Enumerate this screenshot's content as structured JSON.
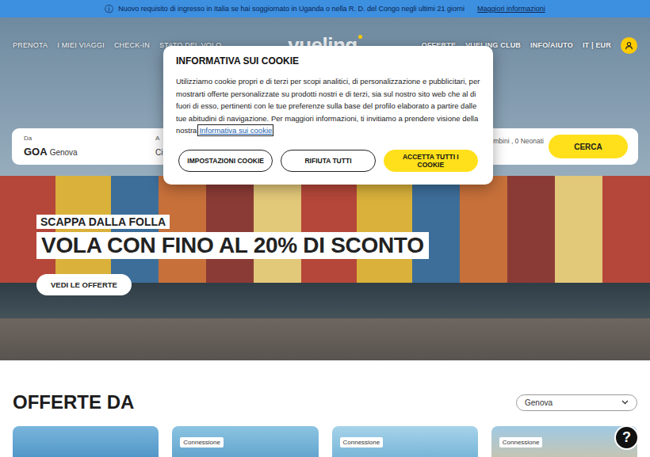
{
  "notice": {
    "icon": "ⓘ",
    "text": "Nuovo requisito di ingresso in Italia se hai soggiornato in Uganda o nella R. D. del Congo negli ultimi 21 giorni",
    "link": "Maggiori informazioni"
  },
  "nav_left": [
    "PRENOTA",
    "I MIEI VIAGGI",
    "CHECK-IN",
    "STATO DEL VOLO"
  ],
  "logo": "vueling",
  "nav_right": [
    "OFFERTE",
    "VUELING CLUB",
    "INFO/AIUTO",
    "IT | EUR"
  ],
  "search": {
    "fields": [
      {
        "label": "Da",
        "code": "GOA",
        "city": "Genova"
      },
      {
        "label": "A",
        "city": "Ci"
      }
    ],
    "passengers": "mbini , 0 Neonati",
    "button": "CERCA"
  },
  "hero": {
    "eyebrow": "SCAPPA DALLA FOLLA",
    "headline": "VOLA CON FINO AL 20% DI SCONTO",
    "button": "VEDI LE OFFERTE"
  },
  "offers": {
    "title": "OFFERTE DA",
    "select": "Genova",
    "cards": [
      {
        "kind": "plain"
      },
      {
        "kind": "tagged",
        "tag": "Connessione"
      },
      {
        "kind": "tagged",
        "tag": "Connessione"
      },
      {
        "kind": "tagged",
        "tag": "Connessione"
      }
    ]
  },
  "help": "?",
  "cookie_modal": {
    "title": "INFORMATIVA SUI COOKIE",
    "text": "Utilizziamo cookie propri e di terzi per scopi analitici, di personalizzazione e pubblicitari, per mostrarti offerte personalizzate su prodotti nostri e di terzi, sia sul nostro sito web che al di fuori di esso, pertinenti con le tue preferenze sulla base del profilo elaborato a partire dalle tue abitudini di navigazione. Per maggiori informazioni, ti invitiamo a prendere visione della nostra",
    "link": "Informativa sui cookie",
    "buttons": [
      {
        "label": "IMPOSTAZIONI COOKIE",
        "kind": "outline"
      },
      {
        "label": "RIFIUTA TUTTI",
        "kind": "outline"
      },
      {
        "label": "ACCETTA TUTTI I COOKIE",
        "kind": "primary"
      }
    ]
  }
}
